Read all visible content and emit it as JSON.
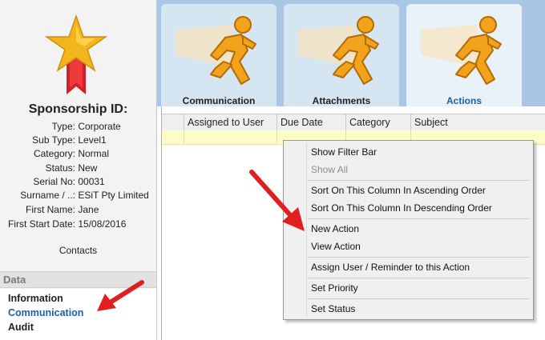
{
  "sponsor": {
    "title": "Sponsorship ID:",
    "fields": [
      {
        "label": "Type:",
        "value": "Corporate"
      },
      {
        "label": "Sub Type:",
        "value": "Level1"
      },
      {
        "label": "Category:",
        "value": "Normal"
      },
      {
        "label": "Status:",
        "value": "New"
      },
      {
        "label": "Serial No:",
        "value": "00031"
      },
      {
        "label": "Surname / ..:",
        "value": "ESiT Pty Limited"
      },
      {
        "label": "First Name:",
        "value": "Jane"
      },
      {
        "label": "First Start Date:",
        "value": "15/08/2016"
      }
    ],
    "contacts": "Contacts"
  },
  "data_panel": {
    "header": "Data",
    "items": [
      "Information",
      "Communication",
      "Audit"
    ],
    "active": "Communication"
  },
  "tabs": [
    {
      "label": "Communication"
    },
    {
      "label": "Attachments"
    },
    {
      "label": "Actions",
      "active": true
    }
  ],
  "grid": {
    "columns": [
      "Assigned to User",
      "Due Date",
      "Category",
      "Subject"
    ]
  },
  "context_menu": {
    "items": [
      {
        "label": "Show Filter Bar",
        "enabled": true
      },
      {
        "label": "Show All",
        "enabled": false
      },
      {
        "label": "Sort On This Column In Ascending Order",
        "enabled": true
      },
      {
        "label": "Sort On This Column In Descending Order",
        "enabled": true
      },
      {
        "label": "New Action",
        "enabled": true
      },
      {
        "label": "View Action",
        "enabled": true
      },
      {
        "label": "Assign User / Reminder to this Action",
        "enabled": true
      },
      {
        "label": "Set Priority",
        "enabled": true
      },
      {
        "label": "Set Status",
        "enabled": true
      }
    ]
  },
  "colors": {
    "accent": "#1f5fa8",
    "tab_strip": "#a9c7e4",
    "filter_row": "#fdfcc8",
    "annotation_arrow": "#e02020"
  },
  "icons": [
    "star-medal-icon",
    "running-man-icon",
    "annotation-arrow"
  ]
}
